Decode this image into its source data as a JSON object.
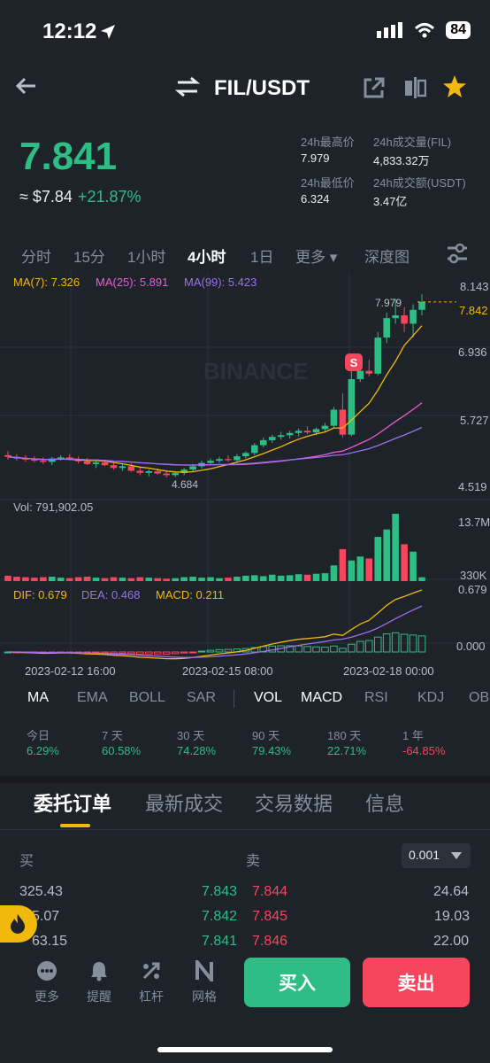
{
  "status": {
    "time": "12:12",
    "battery": "84"
  },
  "header": {
    "pair": "FIL/USDT"
  },
  "ticker": {
    "price": "7.841",
    "usd_price": "≈ $7.84",
    "change": "+21.87%",
    "high_label": "24h最高价",
    "high_value": "7.979",
    "low_label": "24h最低价",
    "low_value": "6.324",
    "vol_label": "24h成交量(FIL)",
    "vol_value": "4,833.32万",
    "amt_label": "24h成交额(USDT)",
    "amt_value": "3.47亿"
  },
  "timeframes": [
    "分时",
    "15分",
    "1小时",
    "4小时",
    "1日",
    "更多 ▾",
    "深度图"
  ],
  "chart": {
    "ma_text": {
      "ma7": "MA(7): 7.326",
      "ma25": "MA(25): 5.891",
      "ma99": "MA(99): 5.423"
    },
    "watermark": "BINANCE",
    "price_ticks": [
      "8.143",
      "6.936",
      "5.727",
      "4.519"
    ],
    "current_price": "7.842",
    "high_marker": "7.979",
    "low_marker": "4.684",
    "signal_label": "S",
    "vol_text": "Vol: 791,902.05",
    "vol_ticks": [
      "13.7M",
      "330K"
    ],
    "macd_text": {
      "dif": "DIF: 0.679",
      "dea": "DEA: 0.468",
      "macd": "MACD: 0.211"
    },
    "macd_ticks": [
      "0.679",
      "0.000"
    ],
    "dates": [
      "2023-02-12 16:00",
      "2023-02-15 08:00",
      "2023-02-18 00:00"
    ],
    "colors": {
      "up": "#2ebd85",
      "down": "#f6465d",
      "ma7": "#f0b90b",
      "ma25": "#e95bd1",
      "ma99": "#9b6ff0"
    }
  },
  "chart_data": {
    "type": "candlestick",
    "interval": "4小时",
    "candles": [
      [
        5.08,
        5.15,
        5.0,
        5.05
      ],
      [
        5.05,
        5.1,
        4.98,
        5.02
      ],
      [
        5.02,
        5.08,
        4.96,
        5.0
      ],
      [
        5.0,
        5.06,
        4.95,
        4.98
      ],
      [
        4.98,
        5.04,
        4.92,
        4.96
      ],
      [
        4.96,
        5.05,
        4.9,
        5.02
      ],
      [
        5.02,
        5.08,
        4.98,
        5.04
      ],
      [
        5.04,
        5.1,
        4.99,
        5.01
      ],
      [
        5.01,
        5.06,
        4.93,
        4.97
      ],
      [
        4.97,
        5.03,
        4.9,
        4.92
      ],
      [
        4.92,
        4.99,
        4.85,
        4.95
      ],
      [
        4.95,
        5.0,
        4.88,
        4.9
      ],
      [
        4.9,
        4.95,
        4.82,
        4.85
      ],
      [
        4.85,
        4.92,
        4.8,
        4.88
      ],
      [
        4.88,
        4.93,
        4.78,
        4.8
      ],
      [
        4.8,
        4.86,
        4.72,
        4.76
      ],
      [
        4.76,
        4.82,
        4.7,
        4.79
      ],
      [
        4.79,
        4.84,
        4.73,
        4.75
      ],
      [
        4.75,
        4.8,
        4.68,
        4.72
      ],
      [
        4.72,
        4.78,
        4.684,
        4.76
      ],
      [
        4.76,
        4.85,
        4.72,
        4.82
      ],
      [
        4.82,
        4.92,
        4.78,
        4.88
      ],
      [
        4.88,
        4.98,
        4.84,
        4.94
      ],
      [
        4.94,
        5.02,
        4.9,
        4.98
      ],
      [
        4.98,
        5.05,
        4.94,
        5.01
      ],
      [
        5.01,
        5.08,
        4.96,
        4.99
      ],
      [
        4.99,
        5.1,
        4.95,
        5.06
      ],
      [
        5.06,
        5.15,
        5.02,
        5.12
      ],
      [
        5.12,
        5.3,
        5.08,
        5.26
      ],
      [
        5.26,
        5.4,
        5.22,
        5.35
      ],
      [
        5.35,
        5.45,
        5.3,
        5.41
      ],
      [
        5.41,
        5.5,
        5.36,
        5.44
      ],
      [
        5.44,
        5.52,
        5.38,
        5.48
      ],
      [
        5.48,
        5.56,
        5.42,
        5.52
      ],
      [
        5.52,
        5.6,
        5.46,
        5.49
      ],
      [
        5.49,
        5.58,
        5.44,
        5.55
      ],
      [
        5.55,
        5.66,
        5.5,
        5.61
      ],
      [
        5.61,
        5.95,
        5.58,
        5.9
      ],
      [
        5.9,
        6.2,
        5.4,
        5.45
      ],
      [
        5.45,
        6.6,
        5.42,
        6.45
      ],
      [
        6.45,
        6.9,
        6.4,
        6.6
      ],
      [
        6.6,
        6.8,
        6.5,
        6.55
      ],
      [
        6.55,
        7.3,
        6.52,
        7.2
      ],
      [
        7.2,
        7.65,
        7.1,
        7.55
      ],
      [
        7.55,
        7.9,
        7.45,
        7.6
      ],
      [
        7.6,
        7.75,
        7.3,
        7.45
      ],
      [
        7.45,
        7.8,
        7.2,
        7.7
      ],
      [
        7.7,
        7.979,
        7.6,
        7.842
      ]
    ],
    "volume": [
      1.1,
      0.9,
      0.8,
      0.7,
      0.8,
      0.9,
      0.7,
      0.6,
      0.8,
      0.9,
      0.7,
      0.6,
      0.8,
      0.7,
      0.6,
      0.8,
      0.7,
      0.6,
      0.5,
      0.6,
      0.8,
      0.9,
      0.7,
      0.8,
      0.6,
      0.7,
      0.9,
      1.1,
      1.2,
      1.0,
      1.3,
      1.1,
      1.2,
      1.4,
      1.3,
      1.5,
      1.6,
      3.2,
      6.5,
      4.2,
      5.0,
      4.6,
      9.0,
      10.5,
      13.7,
      7.5,
      6.0,
      0.79
    ],
    "ylim": [
      4.519,
      8.143
    ]
  },
  "indicators": [
    "MA",
    "EMA",
    "BOLL",
    "SAR",
    "VOL",
    "MACD",
    "RSI",
    "KDJ",
    "OB"
  ],
  "performance": [
    {
      "label": "今日",
      "value": "6.29%"
    },
    {
      "label": "7 天",
      "value": "60.58%"
    },
    {
      "label": "30 天",
      "value": "74.28%"
    },
    {
      "label": "90 天",
      "value": "79.43%"
    },
    {
      "label": "180 天",
      "value": "22.71%"
    },
    {
      "label": "1 年",
      "value": "-64.85%"
    }
  ],
  "tabs": [
    "委托订单",
    "最新成交",
    "交易数据",
    "信息"
  ],
  "orderbook": {
    "buy_label": "买",
    "sell_label": "卖",
    "precision": "0.001",
    "rows": [
      {
        "bid_amt": "325.43",
        "bid_price": "7.843",
        "ask_price": "7.844",
        "ask_amt": "24.64"
      },
      {
        "bid_amt": "5.07",
        "bid_price": "7.842",
        "ask_price": "7.845",
        "ask_amt": "19.03"
      },
      {
        "bid_amt": "63.15",
        "bid_price": "7.841",
        "ask_price": "7.846",
        "ask_amt": "22.00"
      }
    ]
  },
  "nav": [
    {
      "label": "更多",
      "icon": "more-icon"
    },
    {
      "label": "提醒",
      "icon": "bell-icon"
    },
    {
      "label": "杠杆",
      "icon": "leverage-icon"
    },
    {
      "label": "网格",
      "icon": "grid-icon"
    }
  ],
  "actions": {
    "buy": "买入",
    "sell": "卖出"
  }
}
